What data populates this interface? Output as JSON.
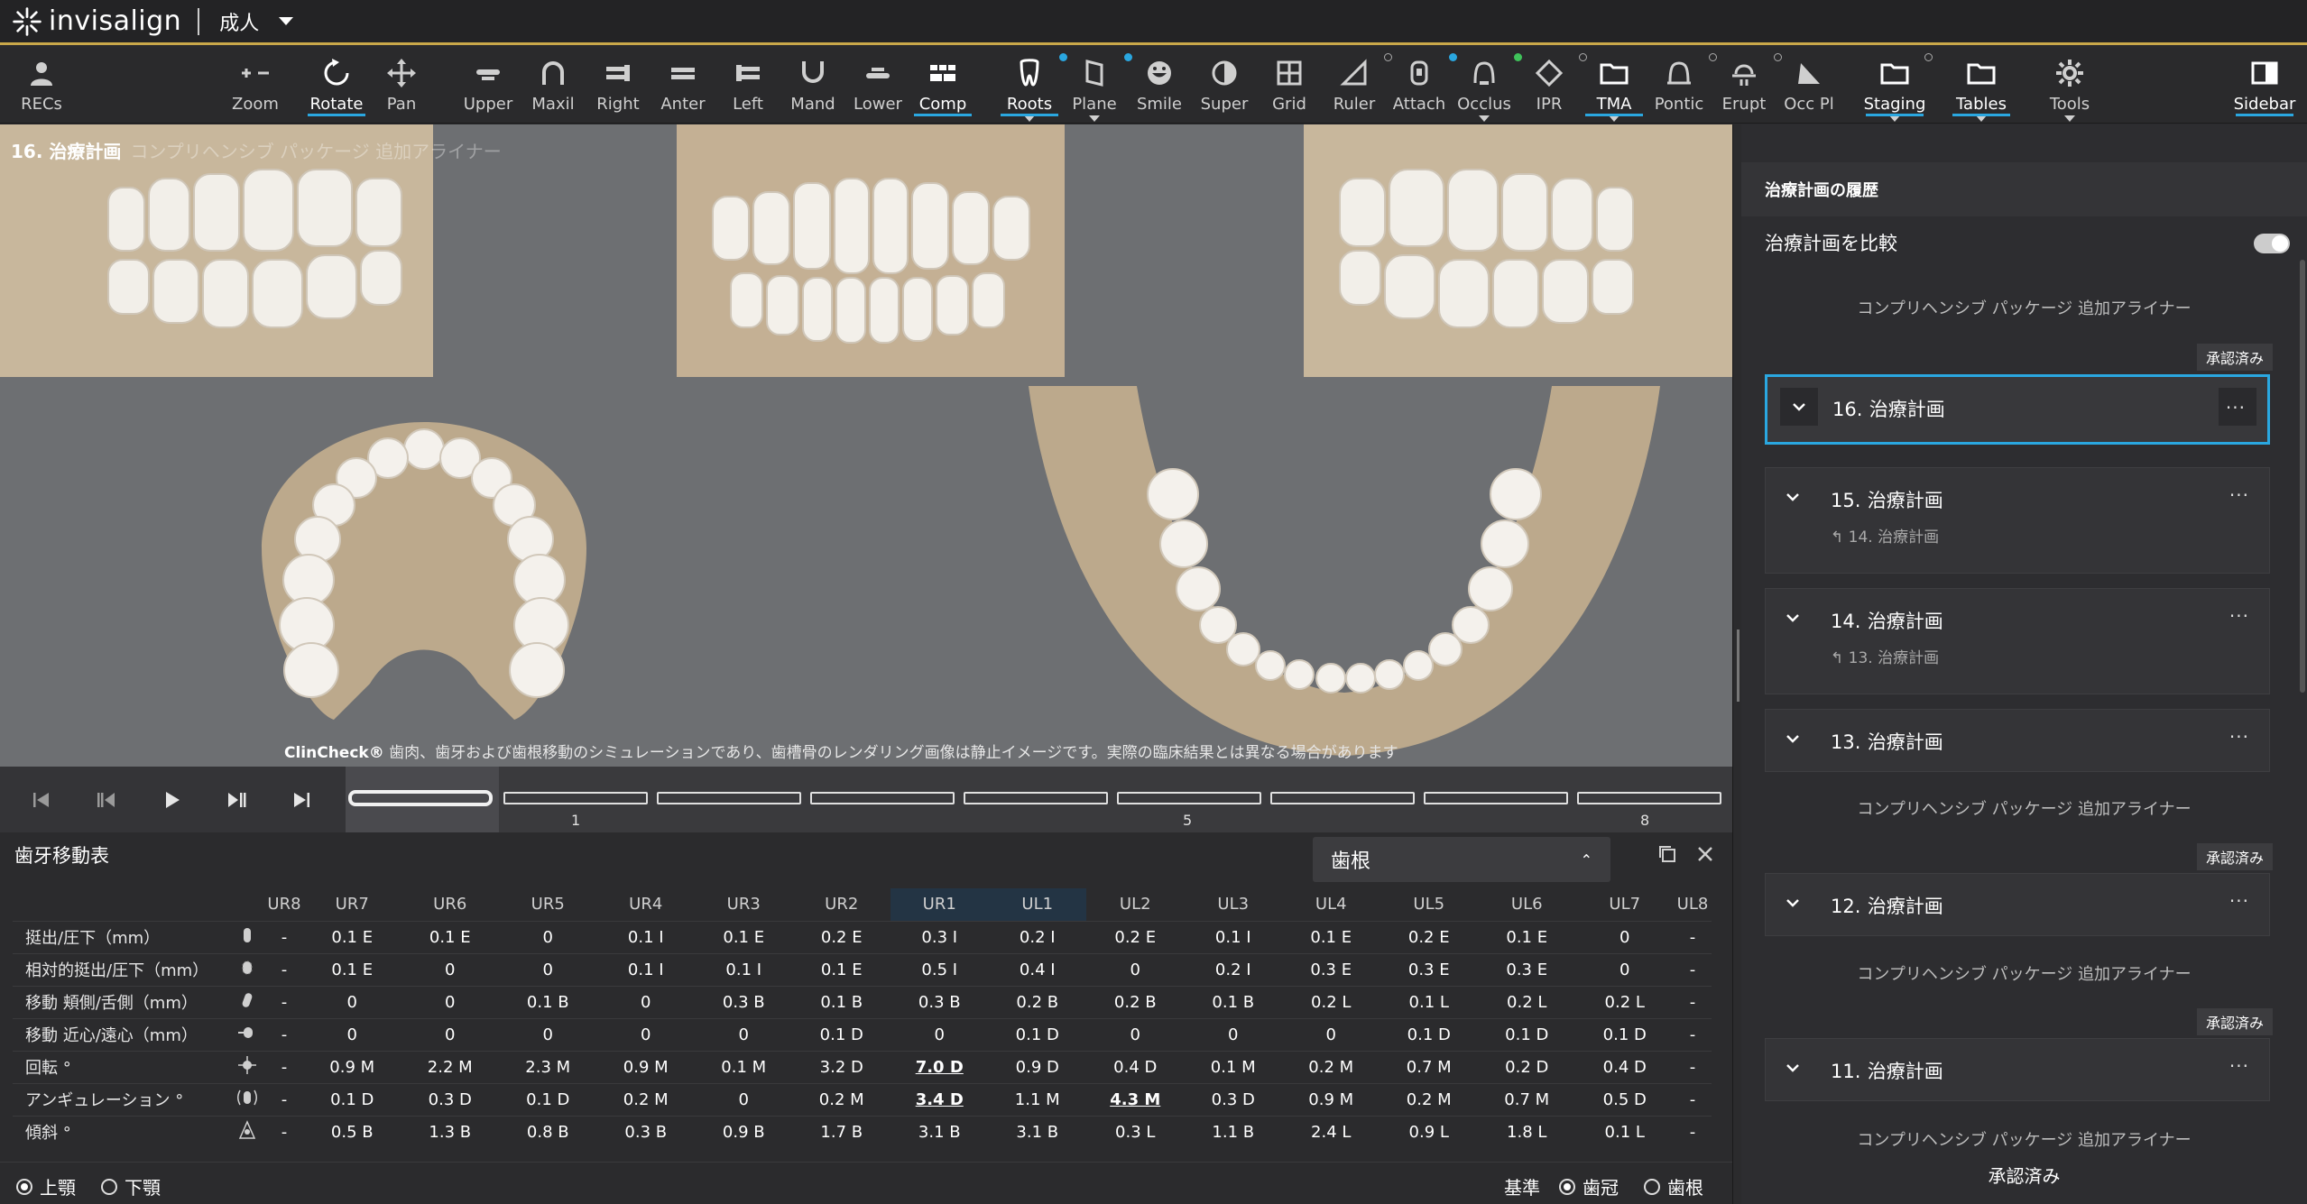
{
  "topbar": {
    "brand": "invisalign",
    "case_type": "成人"
  },
  "toolbar": {
    "tools": [
      {
        "label": "RECs",
        "icon": "person-icon"
      },
      {
        "label": "Zoom",
        "icon": "zoom-icon"
      },
      {
        "label": "Rotate",
        "icon": "rotate-icon",
        "active": true
      },
      {
        "label": "Pan",
        "icon": "pan-icon"
      },
      {
        "label": "Upper",
        "icon": "upper-icon"
      },
      {
        "label": "Maxil",
        "icon": "maxil-icon"
      },
      {
        "label": "Right",
        "icon": "right-icon"
      },
      {
        "label": "Anter",
        "icon": "anter-icon"
      },
      {
        "label": "Left",
        "icon": "left-icon"
      },
      {
        "label": "Mand",
        "icon": "mand-icon"
      },
      {
        "label": "Lower",
        "icon": "lower-icon"
      },
      {
        "label": "Comp",
        "icon": "comp-icon",
        "active": true
      },
      {
        "label": "Roots",
        "icon": "roots-icon",
        "active": true
      },
      {
        "label": "Plane",
        "icon": "plane-icon"
      },
      {
        "label": "Smile",
        "icon": "smile-icon"
      },
      {
        "label": "Super",
        "icon": "super-icon"
      },
      {
        "label": "Grid",
        "icon": "grid-icon"
      },
      {
        "label": "Ruler",
        "icon": "ruler-icon"
      },
      {
        "label": "Attach",
        "icon": "attach-icon"
      },
      {
        "label": "Occlus",
        "icon": "occlus-icon"
      },
      {
        "label": "IPR",
        "icon": "ipr-icon"
      },
      {
        "label": "TMA",
        "icon": "tma-icon",
        "active": true
      },
      {
        "label": "Pontic",
        "icon": "pontic-icon"
      },
      {
        "label": "Erupt",
        "icon": "erupt-icon"
      },
      {
        "label": "Occ Pl",
        "icon": "occ-plane-icon"
      },
      {
        "label": "Staging",
        "icon": "staging-icon",
        "active": true
      },
      {
        "label": "Tables",
        "icon": "tables-icon",
        "active": true
      },
      {
        "label": "Tools",
        "icon": "gear-icon"
      },
      {
        "label": "Sidebar",
        "icon": "sidebar-icon",
        "active": true
      }
    ],
    "colors": {
      "active_underline": "#2aa7e0",
      "dot_blue": "#2aa7e0",
      "dot_green": "#3fc25a"
    }
  },
  "viewer": {
    "title": "16. 治療計画",
    "title_ghost": "コンプリヘンシブ パッケージ 追加アライナー",
    "disclaimer_brand": "ClinCheck®",
    "disclaimer": "歯肉、歯牙および歯根移動のシミュレーションであり、歯槽骨のレンダリング画像は静止イメージです。実際の臨床結果とは異なる場合があります"
  },
  "timeline": {
    "stage_labels": [
      "1",
      "5",
      "8"
    ]
  },
  "table": {
    "title": "歯牙移動表",
    "dropdown_value": "歯根",
    "columns": [
      "UR8",
      "UR7",
      "UR6",
      "UR5",
      "UR4",
      "UR3",
      "UR2",
      "UR1",
      "UL1",
      "UL2",
      "UL3",
      "UL4",
      "UL5",
      "UL6",
      "UL7",
      "UL8"
    ],
    "rows": [
      {
        "label": "挺出/圧下（mm）",
        "icon": "extrusion-icon",
        "values": [
          "-",
          "0.1 E",
          "0.1 E",
          "0",
          "0.1 I",
          "0.1 E",
          "0.2 E",
          "0.3 I",
          "0.2 I",
          "0.2 E",
          "0.1 I",
          "0.1 E",
          "0.2 E",
          "0.1 E",
          "0",
          "-"
        ]
      },
      {
        "label": "相対的挺出/圧下（mm）",
        "icon": "relative-extrusion-icon",
        "values": [
          "-",
          "0.1 E",
          "0",
          "0",
          "0.1 I",
          "0.1 I",
          "0.1 E",
          "0.5 I",
          "0.4 I",
          "0",
          "0.2 I",
          "0.3 E",
          "0.3 E",
          "0.3 E",
          "0",
          "-"
        ]
      },
      {
        "label": "移動 頬側/舌側（mm）",
        "icon": "buccal-lingual-icon",
        "values": [
          "-",
          "0",
          "0",
          "0.1 B",
          "0",
          "0.3 B",
          "0.1 B",
          "0.3 B",
          "0.2 B",
          "0.2 B",
          "0.1 B",
          "0.2 L",
          "0.1 L",
          "0.2 L",
          "0.2 L",
          "-"
        ]
      },
      {
        "label": "移動 近心/遠心（mm）",
        "icon": "mesial-distal-icon",
        "values": [
          "-",
          "0",
          "0",
          "0",
          "0",
          "0",
          "0.1 D",
          "0",
          "0.1 D",
          "0",
          "0",
          "0",
          "0.1 D",
          "0.1 D",
          "0.1 D",
          "-"
        ]
      },
      {
        "label": "回転 °",
        "icon": "rotation-icon",
        "values": [
          "-",
          "0.9 M",
          "2.2 M",
          "2.3 M",
          "0.9 M",
          "0.1 M",
          "3.2 D",
          "7.0 D",
          "0.9 D",
          "0.4 D",
          "0.1 M",
          "0.2 M",
          "0.7 M",
          "0.2 D",
          "0.4 D",
          "-"
        ]
      },
      {
        "label": "アンギュレーション °",
        "icon": "angulation-icon",
        "values": [
          "-",
          "0.1 D",
          "0.3 D",
          "0.1 D",
          "0.2 M",
          "0",
          "0.2 M",
          "3.4 D",
          "1.1 M",
          "4.3 M",
          "0.3 D",
          "0.9 M",
          "0.2 M",
          "0.7 M",
          "0.5 D",
          "-"
        ]
      },
      {
        "label": "傾斜 °",
        "icon": "inclination-icon",
        "values": [
          "-",
          "0.5 B",
          "1.3 B",
          "0.8 B",
          "0.3 B",
          "0.9 B",
          "1.7 B",
          "3.1 B",
          "3.1 B",
          "0.3 L",
          "1.1 B",
          "2.4 L",
          "0.9 L",
          "1.8 L",
          "0.1 L",
          "-"
        ]
      }
    ],
    "underlined": [
      [
        4,
        7
      ],
      [
        5,
        7
      ],
      [
        5,
        9
      ]
    ]
  },
  "footer": {
    "arch_upper": "上顎",
    "arch_lower": "下顎",
    "base_label": "基準",
    "base_crown": "歯冠",
    "base_root": "歯根"
  },
  "sidebar": {
    "header": "治療計画の履歴",
    "compare_label": "治療計画を比較",
    "package_label": "コンプリヘンシブ パッケージ 追加アライナー",
    "approved": "承認済み",
    "plans": [
      {
        "num": "16.",
        "name": "治療計画",
        "sub": ""
      },
      {
        "num": "15.",
        "name": "治療計画",
        "sub": "14. 治療計画"
      },
      {
        "num": "14.",
        "name": "治療計画",
        "sub": "13. 治療計画"
      },
      {
        "num": "13.",
        "name": "治療計画",
        "sub": ""
      },
      {
        "num": "12.",
        "name": "治療計画",
        "sub": ""
      },
      {
        "num": "11.",
        "name": "治療計画",
        "sub": ""
      }
    ]
  }
}
